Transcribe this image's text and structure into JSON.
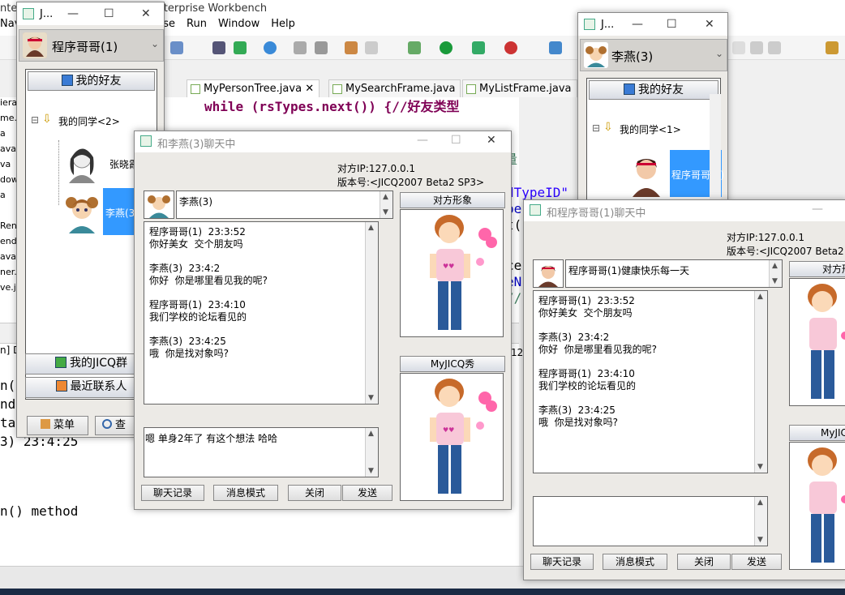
{
  "ide": {
    "title": "ntei                                         onTree.java - MyEclipse Enterprise Workbench",
    "menu": [
      "Nav",
      "ipse",
      "Run",
      "Window",
      "Help"
    ],
    "editor_tabs": [
      "MyPersonTree.java",
      "MySearchFrame.java",
      "MyListFrame.java"
    ],
    "code_lines": {
      "while": "while (rsTypes.next()) {//好友类型",
      "l_typeid": "dTypeID\"",
      "l_pe": "pe",
      "l_t": "t(",
      "l_ce": "ce",
      "l_en": "eN",
      "l_sl": "//",
      "l_hao": "量",
      "bot1": "n()",
      "bot2": "nd",
      "bot3": "tai",
      "bot4": "3) 23:4:25",
      "bot5": "n() method",
      "bot_num": "12"
    },
    "left_files": [
      "ierar",
      "me.ja",
      "a",
      "ava",
      "va",
      "dow",
      "a",
      "",
      "Renc",
      "end",
      "ava",
      "ner.",
      "ve.ja"
    ],
    "left_bracket": "n]  D"
  },
  "main_win": {
    "title": "J...",
    "user": "程序哥哥(1)",
    "my_friends": "我的好友",
    "group": "我的同学<2>",
    "friends": [
      {
        "name": "张晓霞"
      },
      {
        "name": "李燕(3)"
      }
    ],
    "jicq_group": "我的JICQ群",
    "recent": "最近联系人",
    "menu_btn": "菜单",
    "search_btn": "查"
  },
  "chat1": {
    "title": "和李燕(3)聊天中",
    "ip": "对方IP:127.0.0.1",
    "version": "版本号:<JICQ2007 Beta2 SP3>",
    "peer": "李燕(3)",
    "peer_image_label": "对方形象",
    "show_label": "MyJICQ秀",
    "messages": [
      {
        "who": "程序哥哥(1)  23:3:52",
        "text": "你好美女  交个朋友吗"
      },
      {
        "who": "李燕(3)  23:4:2",
        "text": "你好  你是哪里看见我的呢?"
      },
      {
        "who": "程序哥哥(1)  23:4:10",
        "text": "我们学校的论坛看见的"
      },
      {
        "who": "李燕(3)  23:4:25",
        "text": "哦  你是找对象吗?"
      }
    ],
    "input": "嗯 单身2年了 有这个想法 哈哈",
    "buttons": [
      "聊天记录",
      "消息模式",
      "关闭",
      "发送"
    ]
  },
  "right_win": {
    "title": "J...",
    "user": "李燕(3)",
    "my_friends": "我的好友",
    "group": "我的同学<1>",
    "friend": "程序哥哥(1)"
  },
  "chat2": {
    "title": "和程序哥哥(1)聊天中",
    "ip": "对方IP:127.0.0.1",
    "version": "版本号:<JICQ2007 Beta2 S",
    "peer": "程序哥哥(1)健康快乐每一天",
    "peer_image_label": "对方形",
    "show_label": "MyJIC",
    "messages": [
      {
        "who": "程序哥哥(1)  23:3:52",
        "text": "你好美女  交个朋友吗"
      },
      {
        "who": "李燕(3)  23:4:2",
        "text": "你好  你是哪里看见我的呢?"
      },
      {
        "who": "程序哥哥(1)  23:4:10",
        "text": "我们学校的论坛看见的"
      },
      {
        "who": "李燕(3)  23:4:25",
        "text": "哦  你是找对象吗?"
      }
    ],
    "input": "",
    "buttons": [
      "聊天记录",
      "消息模式",
      "关闭",
      "发送"
    ]
  },
  "colors": {
    "accent": "#3399ff",
    "code_keyword": "#7f0055",
    "code_comment": "#3f7f5f",
    "code_string": "#2a00ff"
  }
}
